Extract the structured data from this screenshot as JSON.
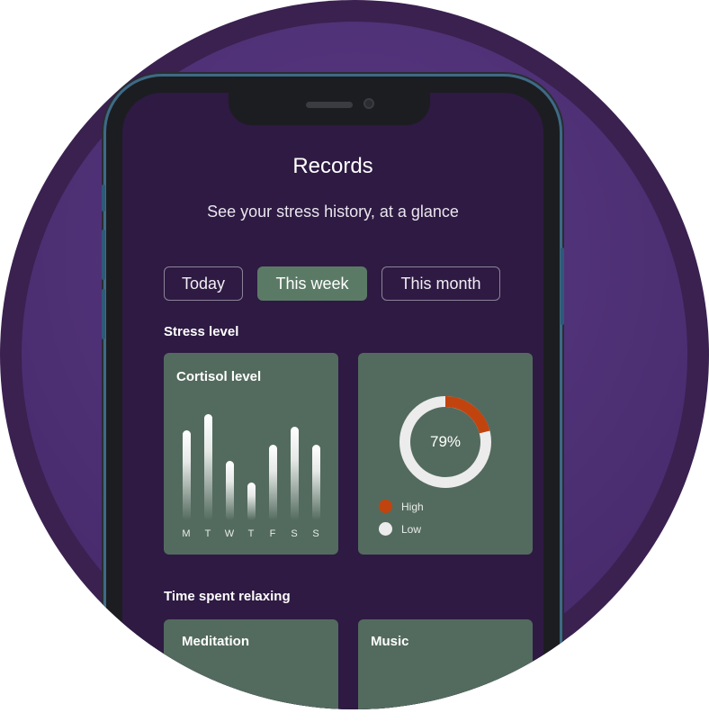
{
  "app": {
    "title": "Records",
    "subtitle": "See your stress history, at a glance"
  },
  "tabs": [
    {
      "label": "Today",
      "active": false
    },
    {
      "label": "This week",
      "active": true
    },
    {
      "label": "This month",
      "active": false
    }
  ],
  "stress_section": {
    "label": "Stress level"
  },
  "cortisol_card": {
    "title": "Cortisol level",
    "chart_data": {
      "type": "bar",
      "categories": [
        "M",
        "T",
        "W",
        "T",
        "F",
        "S",
        "S"
      ],
      "values": [
        100,
        118,
        66,
        42,
        84,
        104,
        84
      ]
    }
  },
  "donut_card": {
    "value_label": "79%",
    "chart_data": {
      "type": "pie",
      "categories": [
        "High",
        "Low"
      ],
      "values": [
        21,
        79
      ]
    },
    "legend": [
      {
        "label": "High",
        "color": "#c1440e"
      },
      {
        "label": "Low",
        "color": "#ececec"
      }
    ]
  },
  "relax_section": {
    "label": "Time spent relaxing",
    "cards": [
      {
        "title": "Meditation"
      },
      {
        "title": "Music"
      }
    ]
  },
  "colors": {
    "background": "#2e1a42",
    "card": "#536b5e",
    "accent_tab": "#5b7a66",
    "high": "#c1440e",
    "low": "#ececec"
  }
}
